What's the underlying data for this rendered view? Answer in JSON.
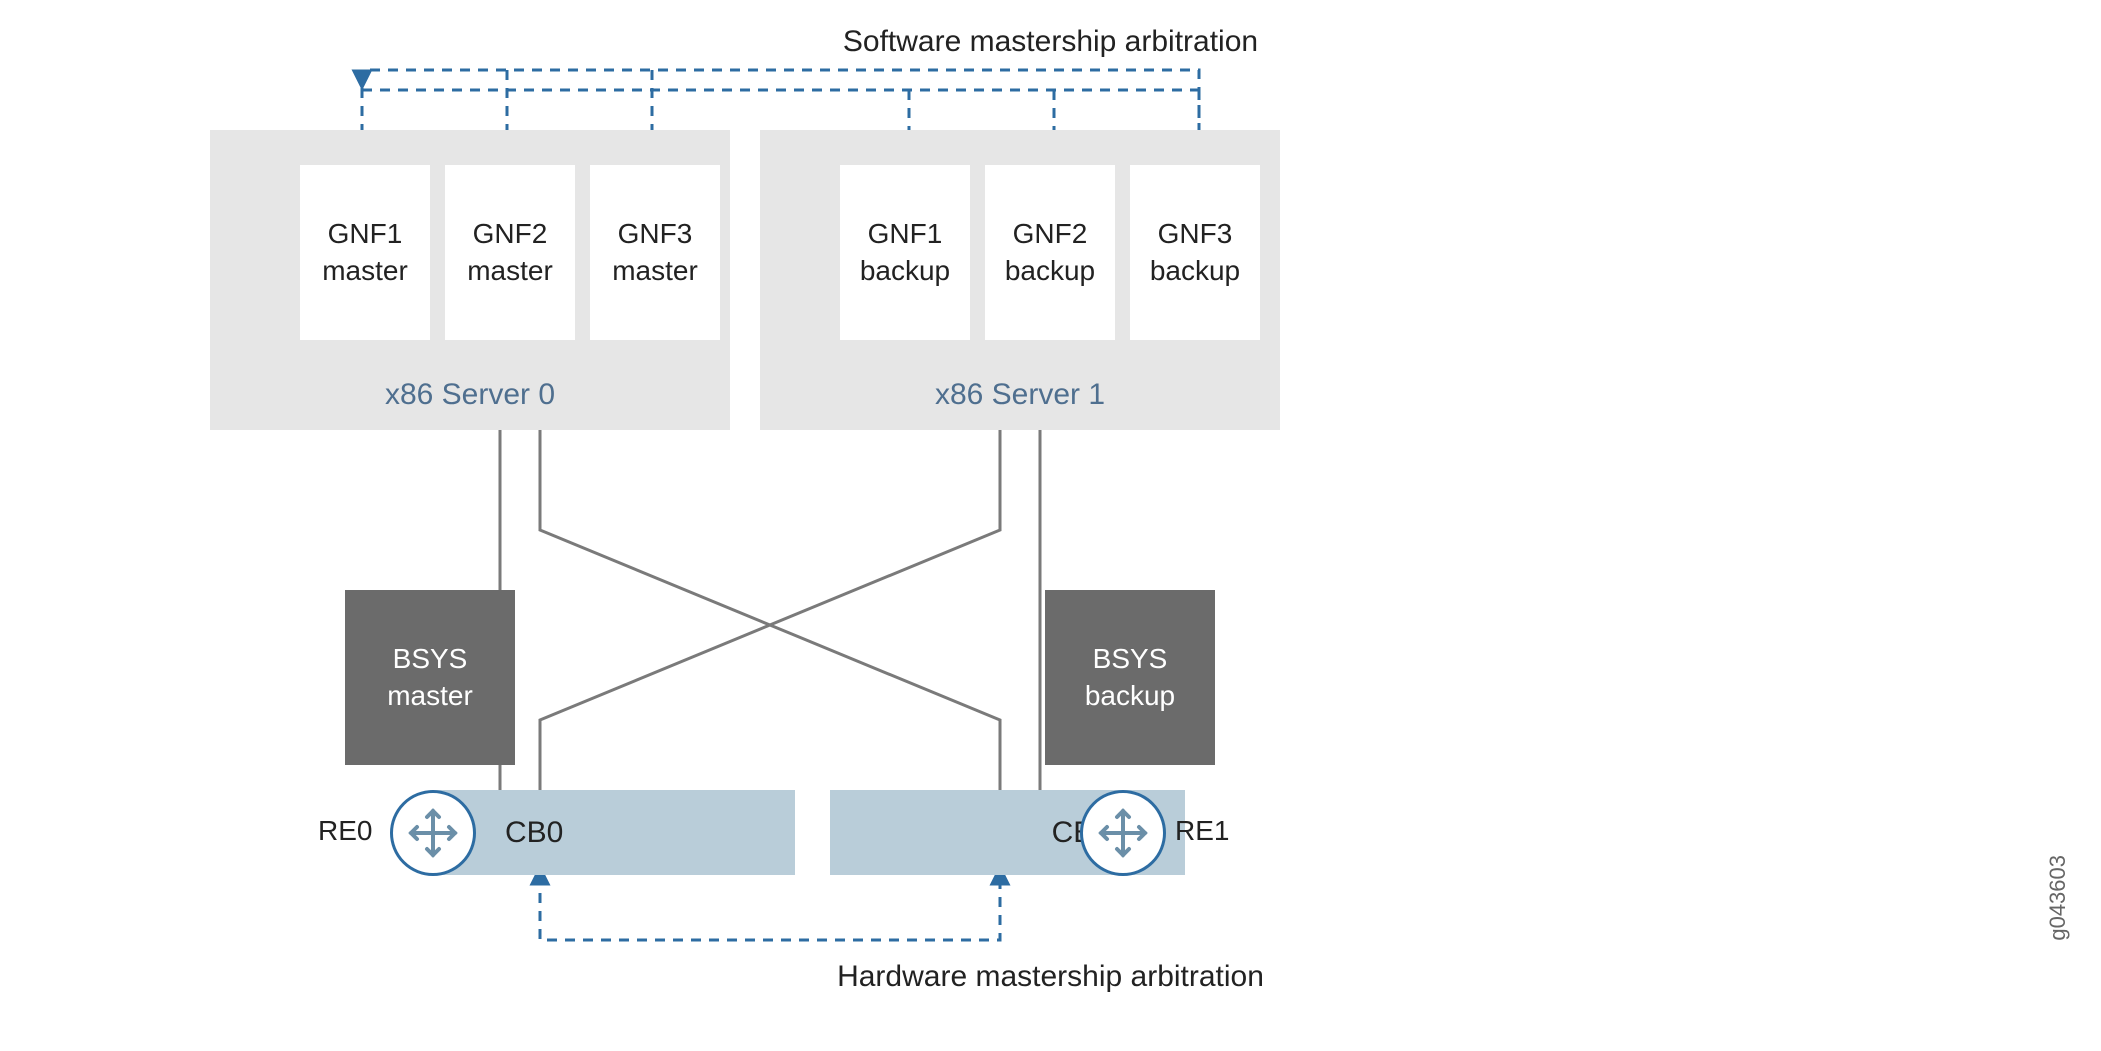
{
  "titles": {
    "software": "Software mastership arbitration",
    "hardware": "Hardware mastership arbitration"
  },
  "servers": {
    "s0": {
      "label": "x86 Server 0"
    },
    "s1": {
      "label": "x86 Server 1"
    }
  },
  "gnfs": {
    "s0g1": "GNF1\nmaster",
    "s0g2": "GNF2\nmaster",
    "s0g3": "GNF3\nmaster",
    "s1g1": "GNF1\nbackup",
    "s1g2": "GNF2\nbackup",
    "s1g3": "GNF3\nbackup"
  },
  "bsys": {
    "b0": "BSYS\nmaster",
    "b1": "BSYS\nbackup"
  },
  "cb": {
    "c0": "CB0",
    "c1": "CB1"
  },
  "re": {
    "r0": "RE0",
    "r1": "RE1"
  },
  "gid": "g043603",
  "chart_data": {
    "type": "diagram",
    "description": "Node slicing mastership arbitration between two x86 servers hosting GNF VMs and two control boards with Routing Engines.",
    "nodes": [
      {
        "id": "server0",
        "type": "server",
        "label": "x86 Server 0",
        "children": [
          "gnf1m",
          "gnf2m",
          "gnf3m"
        ]
      },
      {
        "id": "server1",
        "type": "server",
        "label": "x86 Server 1",
        "children": [
          "gnf1b",
          "gnf2b",
          "gnf3b"
        ]
      },
      {
        "id": "gnf1m",
        "type": "gnf",
        "label": "GNF1 master"
      },
      {
        "id": "gnf2m",
        "type": "gnf",
        "label": "GNF2 master"
      },
      {
        "id": "gnf3m",
        "type": "gnf",
        "label": "GNF3 master"
      },
      {
        "id": "gnf1b",
        "type": "gnf",
        "label": "GNF1 backup"
      },
      {
        "id": "gnf2b",
        "type": "gnf",
        "label": "GNF2 backup"
      },
      {
        "id": "gnf3b",
        "type": "gnf",
        "label": "GNF3 backup"
      },
      {
        "id": "bsys0",
        "type": "bsys",
        "label": "BSYS master"
      },
      {
        "id": "bsys1",
        "type": "bsys",
        "label": "BSYS backup"
      },
      {
        "id": "cb0",
        "type": "cb",
        "label": "CB0"
      },
      {
        "id": "cb1",
        "type": "cb",
        "label": "CB1"
      },
      {
        "id": "re0",
        "type": "re",
        "label": "RE0"
      },
      {
        "id": "re1",
        "type": "re",
        "label": "RE1"
      }
    ],
    "edges": [
      {
        "from": "server0",
        "to": "cb0",
        "style": "solid",
        "kind": "physical"
      },
      {
        "from": "server0",
        "to": "cb1",
        "style": "solid",
        "kind": "physical"
      },
      {
        "from": "server1",
        "to": "cb0",
        "style": "solid",
        "kind": "physical"
      },
      {
        "from": "server1",
        "to": "cb1",
        "style": "solid",
        "kind": "physical"
      },
      {
        "from": "gnf1m",
        "to": "software_arbitration",
        "style": "dashed",
        "kind": "sw-mastership"
      },
      {
        "from": "gnf2m",
        "to": "software_arbitration",
        "style": "dashed",
        "kind": "sw-mastership"
      },
      {
        "from": "gnf3m",
        "to": "software_arbitration",
        "style": "dashed",
        "kind": "sw-mastership"
      },
      {
        "from": "gnf1b",
        "to": "software_arbitration",
        "style": "dashed",
        "kind": "sw-mastership"
      },
      {
        "from": "gnf2b",
        "to": "software_arbitration",
        "style": "dashed",
        "kind": "sw-mastership"
      },
      {
        "from": "gnf3b",
        "to": "software_arbitration",
        "style": "dashed",
        "kind": "sw-mastership"
      },
      {
        "from": "cb0",
        "to": "hardware_arbitration",
        "style": "dashed",
        "kind": "hw-mastership"
      },
      {
        "from": "cb1",
        "to": "hardware_arbitration",
        "style": "dashed",
        "kind": "hw-mastership"
      },
      {
        "from": "re0",
        "to": "cb0",
        "style": "attached",
        "kind": "attached"
      },
      {
        "from": "re1",
        "to": "cb1",
        "style": "attached",
        "kind": "attached"
      }
    ]
  }
}
